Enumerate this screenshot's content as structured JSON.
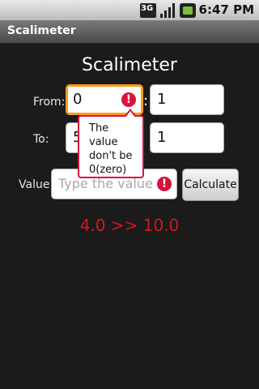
{
  "status_bar": {
    "network_label": "3G",
    "time": "6:47 PM",
    "icons": [
      "network-3g-icon",
      "signal-icon",
      "battery-icon"
    ]
  },
  "app": {
    "title": "Scalimeter"
  },
  "main": {
    "heading": "Scalimeter",
    "from_label": "From:",
    "to_label": "To:",
    "value_label": "Value:",
    "from_value_1": "0",
    "from_value_2": "1",
    "to_value_1": "5",
    "to_value_2": "1",
    "colon": ":",
    "value_placeholder": "Type the value",
    "calculate_label": "Calculate",
    "result": "4.0 >> 10.0",
    "error_popup": "The value don't be 0(zero)",
    "error_icon_glyph": "!"
  },
  "colors": {
    "focus_border": "#ff9b1d",
    "error": "#d8123b",
    "result_text": "#d01b1b"
  }
}
